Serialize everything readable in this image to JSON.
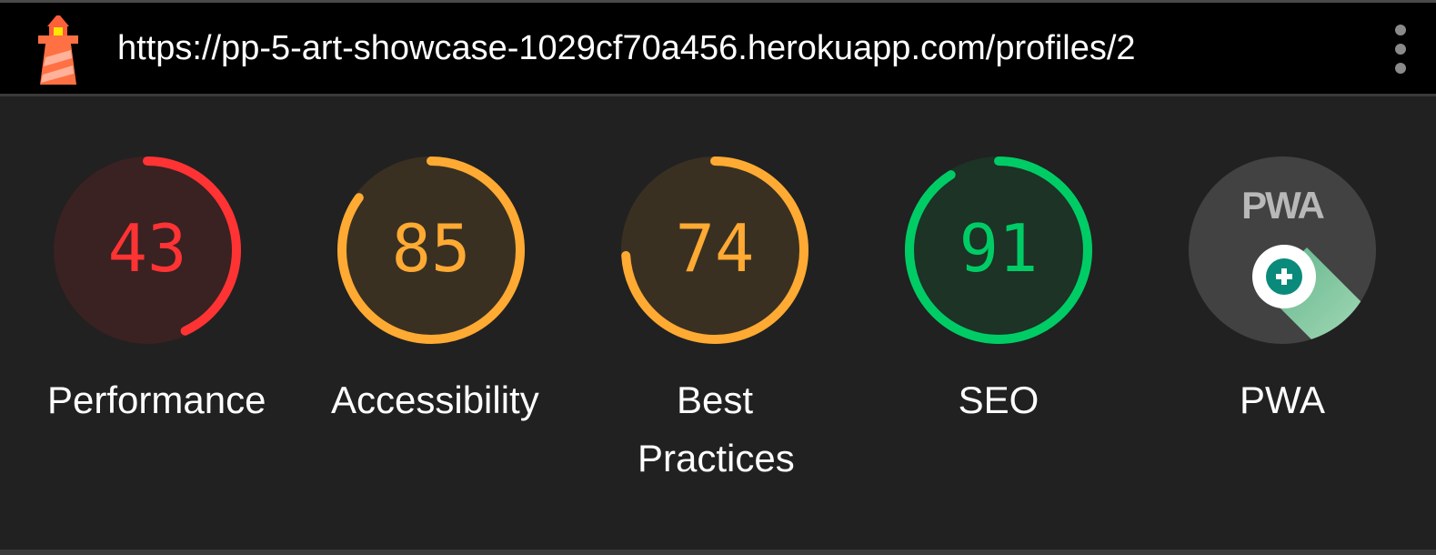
{
  "header": {
    "url": "https://pp-5-art-showcase-1029cf70a456.herokuapp.com/profiles/2",
    "logo_icon": "lighthouse-icon",
    "menu_icon": "kebab-menu-icon"
  },
  "gauges": [
    {
      "id": "performance",
      "label": "Performance",
      "score": 43,
      "value": "43",
      "color": "#ff3333",
      "fill": "#3a2122"
    },
    {
      "id": "accessibility",
      "label": "Accessibility",
      "score": 85,
      "value": "85",
      "color": "#ffaa33",
      "fill": "#3a3022"
    },
    {
      "id": "best-practices",
      "label": "Best Practices",
      "score": 74,
      "value": "74",
      "color": "#ffaa33",
      "fill": "#3a3022"
    },
    {
      "id": "seo",
      "label": "SEO",
      "score": 91,
      "value": "91",
      "color": "#00cc66",
      "fill": "#1c3326"
    }
  ],
  "pwa": {
    "label": "PWA",
    "badge_text": "PWA",
    "icon": "pwa-badge-icon",
    "plus_icon": "plus-icon",
    "fill": "#424242"
  }
}
